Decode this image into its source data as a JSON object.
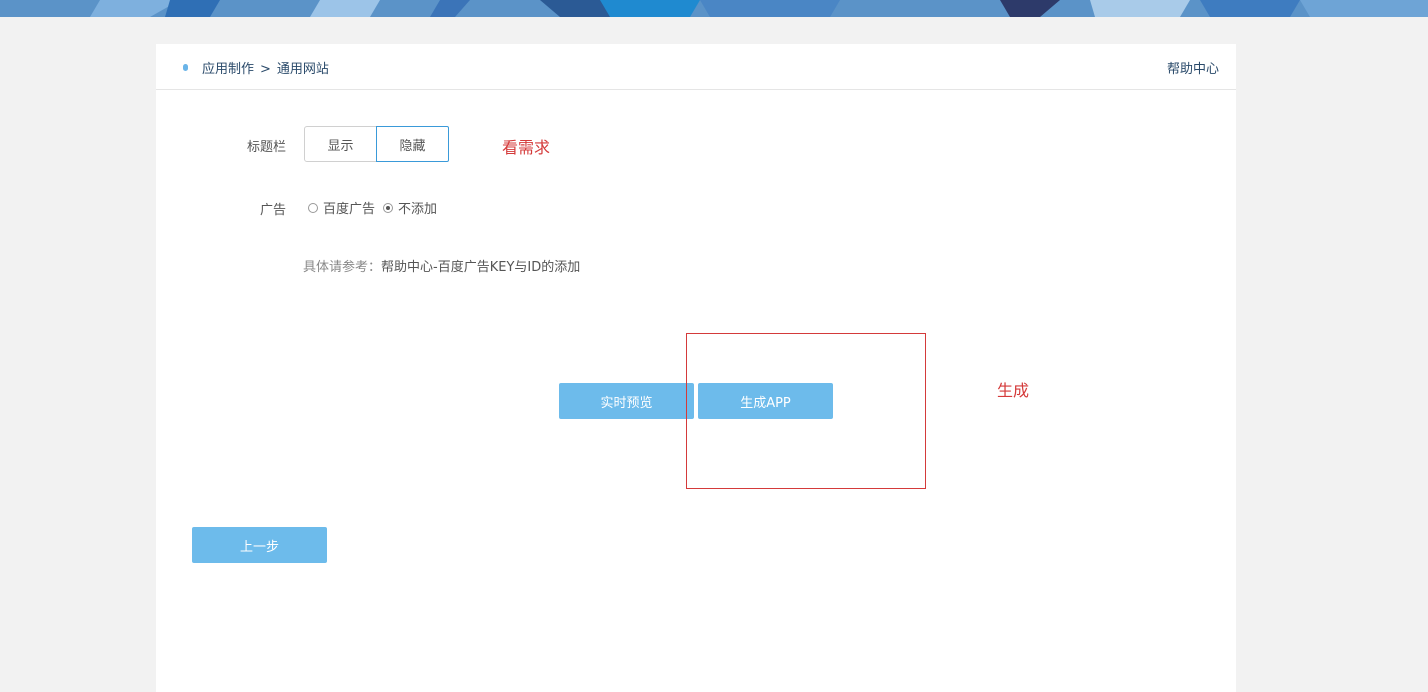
{
  "header": {
    "breadcrumb": [
      "应用制作",
      "通用网站"
    ],
    "breadcrumb_sep": ">",
    "help": "帮助中心"
  },
  "title_bar": {
    "label": "标题栏",
    "options": [
      "显示",
      "隐藏"
    ],
    "selected": "隐藏"
  },
  "ads": {
    "label": "广告",
    "options": [
      "百度广告",
      "不添加"
    ],
    "selected": "不添加"
  },
  "hint": {
    "prefix": "具体请参考：",
    "link": "帮助中心-百度广告KEY与ID的添加"
  },
  "actions": {
    "preview": "实时预览",
    "generate": "生成APP",
    "prev": "上一步"
  },
  "annotations": {
    "note1": "看需求",
    "note2": "生成",
    "color": "#d43a3a"
  },
  "colors": {
    "accent": "#6dbbeb",
    "active_border": "#3a9ad9",
    "banner": "#5b93c8"
  }
}
